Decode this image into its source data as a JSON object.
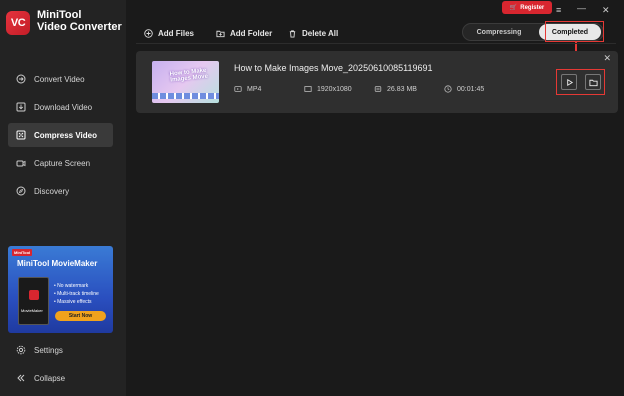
{
  "app": {
    "brand_line1": "MiniTool",
    "brand_line2": "Video Converter",
    "logo_text": "VC"
  },
  "sidebar": {
    "items": [
      {
        "label": "Convert Video",
        "icon": "convert-icon",
        "active": false
      },
      {
        "label": "Download Video",
        "icon": "download-icon",
        "active": false
      },
      {
        "label": "Compress Video",
        "icon": "compress-icon",
        "active": true
      },
      {
        "label": "Capture Screen",
        "icon": "camera-icon",
        "active": false
      },
      {
        "label": "Discovery",
        "icon": "compass-icon",
        "active": false
      }
    ],
    "settings_label": "Settings",
    "collapse_label": "Collapse"
  },
  "promo": {
    "badge": "MiniTool",
    "title": "MiniTool MovieMaker",
    "box_label": "MovieMaker",
    "features": [
      "• No watermark",
      "• Multi-track timeline",
      "• Massive effects"
    ],
    "button": "Start Now"
  },
  "topbar": {
    "register": "Register",
    "menu_icon": "≡",
    "minimize_icon": "—",
    "close_icon": "✕"
  },
  "toolbar": {
    "add_files": "Add Files",
    "add_folder": "Add Folder",
    "delete_all": "Delete All"
  },
  "tabs": {
    "compressing": "Compressing",
    "completed": "Completed",
    "selected": "Completed"
  },
  "file": {
    "name": "How to Make Images Move_20250610085119691",
    "format": "MP4",
    "resolution": "1920x1080",
    "size": "26.83 MB",
    "duration": "00:01:45",
    "thumb_text": "How to Make Images Move"
  },
  "colors": {
    "accent_red": "#d8262f",
    "highlight": "#e53935"
  }
}
